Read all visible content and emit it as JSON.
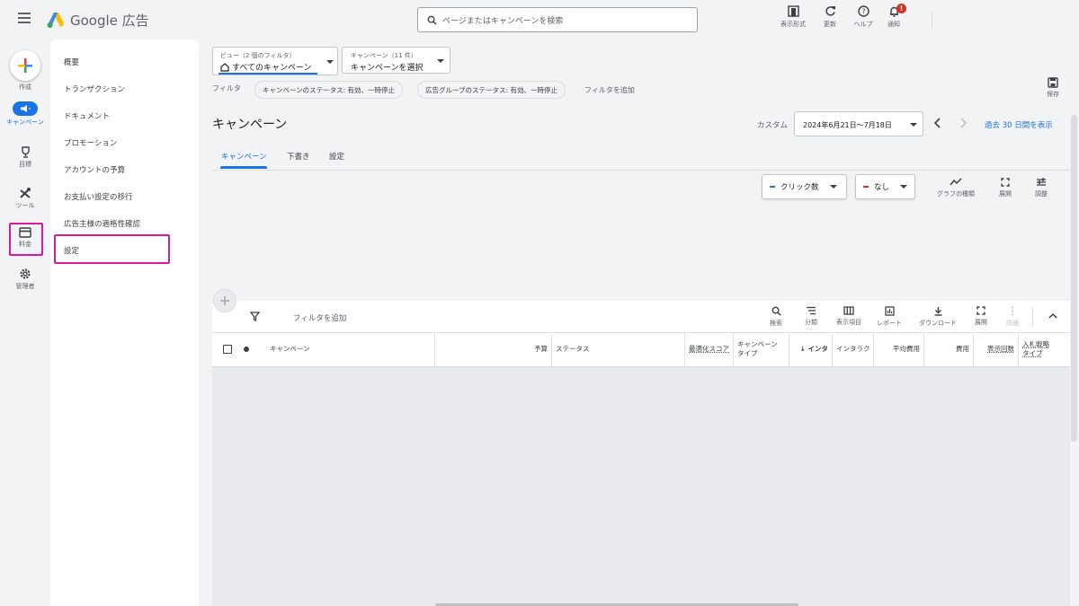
{
  "header": {
    "app_name": "Google 広告",
    "search_placeholder": "ページまたはキャンペーンを検索",
    "buttons": {
      "display_format": "表示形式",
      "refresh": "更新",
      "help": "ヘルプ",
      "notifications": "通知"
    },
    "notification_badge": "!"
  },
  "rail": {
    "create": "作成",
    "campaigns": "キャンペーン",
    "goals": "目標",
    "tools": "ツール",
    "billing": "料金",
    "admin": "管理者"
  },
  "nav": {
    "items": [
      "概要",
      "トランザクション",
      "ドキュメント",
      "プロモーション",
      "アカウントの予算",
      "お支払い設定の移行",
      "広告主様の適格性確認",
      "設定"
    ]
  },
  "view_selector": {
    "label": "ビュー（2 個のフィルタ）",
    "value": "すべてのキャンペーン"
  },
  "campaign_selector": {
    "label": "キャンペーン（11 件）",
    "value": "キャンペーンを選択"
  },
  "filters": {
    "label": "フィルタ",
    "chips": [
      "キャンペーンのステータス: 有効、一時停止",
      "広告グループのステータス: 有効、一時停止"
    ],
    "add": "フィルタを追加"
  },
  "save": "保存",
  "page_title": "キャンペーン",
  "date": {
    "custom_label": "カスタム",
    "range": "2024年6月21日〜7月18日",
    "compare": "過去 30 日間を表示"
  },
  "tabs": [
    "キャンペーン",
    "下書き",
    "設定"
  ],
  "chart_tools": {
    "metric1": "クリック数",
    "metric2": "なし",
    "graph_type": "グラフの種類",
    "expand": "展開",
    "adjust": "調整"
  },
  "table_toolbar": {
    "add_filter": "フィルタを追加",
    "search": "検索",
    "segment": "分類",
    "columns": "表示項目",
    "reports": "レポート",
    "download": "ダウンロード",
    "expand": "展開",
    "details": "詳細"
  },
  "columns": {
    "campaign": "キャンペーン",
    "budget": "予算",
    "status": "ステータス",
    "opt_score": "最適化スコア",
    "campaign_type_1": "キャンペーン",
    "campaign_type_2": "タイプ",
    "interactions_sorted": "↓ インタ",
    "interaction_rate": "インタラク",
    "avg_cost": "平均費用",
    "cost": "費用",
    "impressions": "表示回数",
    "bid_strategy_1": "入札戦略",
    "bid_strategy_2": "タイプ"
  },
  "colors": {
    "accent": "#1a73e8",
    "highlight": "#d81b9c",
    "metric1": "#1a73e8",
    "metric2": "#d93025"
  }
}
